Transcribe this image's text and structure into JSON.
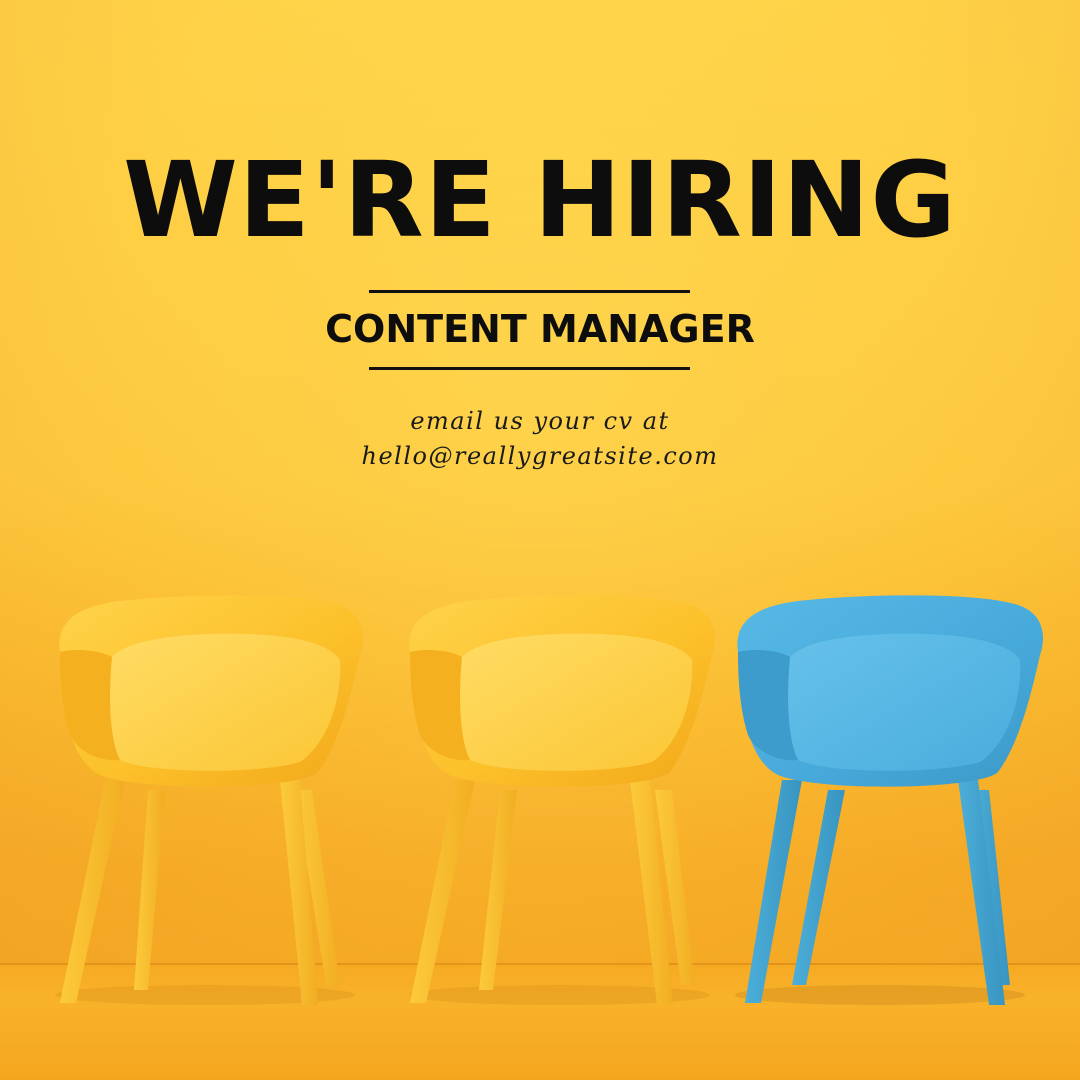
{
  "poster": {
    "headline": "WE'RE HIRING",
    "role": "CONTENT MANAGER",
    "contact_line1": "email us your cv at",
    "contact_line2": "hello@reallygreatsite.com"
  },
  "illustration": {
    "chairs": [
      {
        "color": "yellow"
      },
      {
        "color": "yellow"
      },
      {
        "color": "blue"
      }
    ]
  },
  "colors": {
    "background": "#fdc93e",
    "text": "#0d0d0d",
    "chair_yellow": "#fcc12b",
    "chair_blue": "#4eb1e0"
  }
}
